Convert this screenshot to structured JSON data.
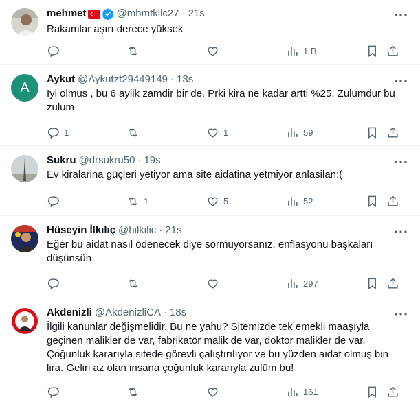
{
  "tweets": [
    {
      "name": "mehmet",
      "has_flag": true,
      "verified": true,
      "handle": "@mhmtkllc27",
      "time": "21s",
      "text": "Rakamlar aşırı derece yüksek",
      "replies": "",
      "retweets": "",
      "likes": "",
      "views": "1 B",
      "avatar": "photo"
    },
    {
      "name": "Aykut",
      "handle": "@Aykutzt29449149",
      "time": "13s",
      "text": "Iyi olmus , bu 6 aylik zamdir bir de. Prki kira ne kadar artti %25. Zulumdur bu zulum",
      "replies": "1",
      "retweets": "",
      "likes": "1",
      "views": "59",
      "avatar": "letter",
      "avatar_letter": "A",
      "avatar_color": "#1b9178"
    },
    {
      "name": "Sukru",
      "handle": "@drsukru50",
      "time": "19s",
      "text": "Ev kiralarina güçleri yetiyor ama site aidatina yetmiyor anlasilan:(",
      "replies": "",
      "retweets": "1",
      "likes": "5",
      "views": "52",
      "avatar": "photo"
    },
    {
      "name": "Hüseyin İlkılıç",
      "handle": "@hilkilic",
      "time": "21s",
      "text": "Eğer bu aidat nasıl ödenecek diye sormuyorsanız, enflasyonu başkaları düşünsün",
      "replies": "",
      "retweets": "",
      "likes": "",
      "views": "297",
      "avatar": "photo"
    },
    {
      "name": "Akdenizli",
      "handle": "@AkdenizliCA",
      "time": "18s",
      "text": "İlgili kanunlar değişmelidir. Bu ne yahu? Sitemizde tek emekli maaşıyla geçinen malikler de var, fabrikatör malik de var, doktor malikler de var. Çoğunluk kararıyla sitede görevli çalıştırılıyor ve bu yüzden aidat olmuş bin lira. Geliri az olan insana çoğunluk kararıyla zulüm bu!",
      "replies": "",
      "retweets": "",
      "likes": "",
      "views": "161",
      "avatar": "photo"
    }
  ],
  "icons": {
    "reply": "reply-icon",
    "retweet": "retweet-icon",
    "like": "like-icon",
    "views": "views-icon",
    "bookmark": "bookmark-icon",
    "share": "share-icon",
    "more": "more-icon",
    "verified": "verified-icon",
    "flag": "turkey-flag-icon"
  },
  "colors": {
    "text": "#0f1419",
    "muted": "#536471",
    "verified": "#1d9bf0",
    "divider": "#eff3f4"
  }
}
